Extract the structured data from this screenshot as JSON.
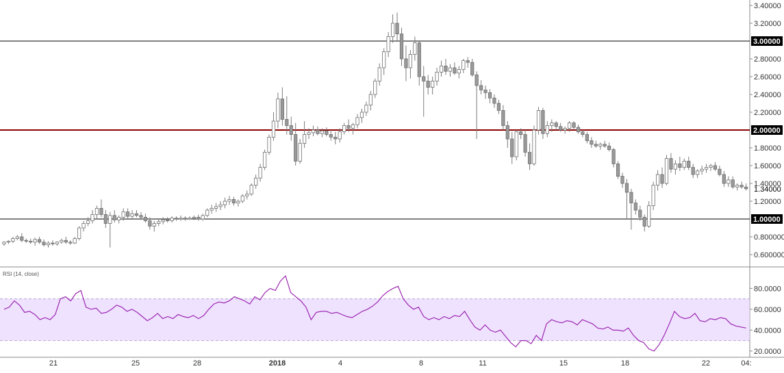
{
  "chart_data": [
    {
      "type": "candlestick",
      "name_label": "",
      "y_ticks": [
        "3.40000",
        "3.20000",
        "2.80000",
        "2.60000",
        "2.40000",
        "2.20000",
        "1.80000",
        "1.60000",
        "1.40000",
        "1.20000",
        "0.800000",
        "0.600000"
      ],
      "y_tick_values": [
        3.4,
        3.2,
        2.8,
        2.6,
        2.4,
        2.2,
        1.8,
        1.6,
        1.4,
        1.2,
        0.8,
        0.6
      ],
      "ylim": [
        0.5,
        3.45
      ],
      "horizontal_lines": [
        {
          "value": 3.0,
          "label": "3.00000",
          "color": "#000000"
        },
        {
          "value": 2.0,
          "label": "2.00000",
          "color": "#8b0000"
        },
        {
          "value": 1.0,
          "label": "1.00000",
          "color": "#000000"
        }
      ],
      "last_price": {
        "value": 1.34,
        "label": "1.34000"
      },
      "candles": [
        [
          0.72,
          0.75,
          0.7,
          0.74
        ],
        [
          0.74,
          0.76,
          0.72,
          0.75
        ],
        [
          0.75,
          0.8,
          0.73,
          0.78
        ],
        [
          0.78,
          0.82,
          0.76,
          0.8
        ],
        [
          0.8,
          0.84,
          0.74,
          0.76
        ],
        [
          0.76,
          0.78,
          0.73,
          0.75
        ],
        [
          0.75,
          0.78,
          0.72,
          0.74
        ],
        [
          0.74,
          0.79,
          0.7,
          0.77
        ],
        [
          0.77,
          0.8,
          0.72,
          0.74
        ],
        [
          0.74,
          0.77,
          0.69,
          0.71
        ],
        [
          0.71,
          0.75,
          0.68,
          0.73
        ],
        [
          0.73,
          0.76,
          0.7,
          0.72
        ],
        [
          0.72,
          0.75,
          0.7,
          0.74
        ],
        [
          0.74,
          0.78,
          0.72,
          0.76
        ],
        [
          0.76,
          0.8,
          0.72,
          0.74
        ],
        [
          0.74,
          0.76,
          0.71,
          0.73
        ],
        [
          0.73,
          0.8,
          0.72,
          0.78
        ],
        [
          0.78,
          0.92,
          0.76,
          0.9
        ],
        [
          0.9,
          0.98,
          0.86,
          0.95
        ],
        [
          0.95,
          1.02,
          0.92,
          0.98
        ],
        [
          0.98,
          1.1,
          0.95,
          1.05
        ],
        [
          1.05,
          1.15,
          1.0,
          1.12
        ],
        [
          1.12,
          1.22,
          1.02,
          1.05
        ],
        [
          1.05,
          1.1,
          0.9,
          0.95
        ],
        [
          0.95,
          1.08,
          0.68,
          1.04
        ],
        [
          1.04,
          1.1,
          0.96,
          0.99
        ],
        [
          0.99,
          1.04,
          0.95,
          1.02
        ],
        [
          1.02,
          1.12,
          0.98,
          1.08
        ],
        [
          1.08,
          1.12,
          1.0,
          1.03
        ],
        [
          1.03,
          1.1,
          1.0,
          1.06
        ],
        [
          1.06,
          1.1,
          1.02,
          1.04
        ],
        [
          1.04,
          1.08,
          0.99,
          1.02
        ],
        [
          1.02,
          1.06,
          0.96,
          0.98
        ],
        [
          0.98,
          1.02,
          0.88,
          0.92
        ],
        [
          0.92,
          0.98,
          0.86,
          0.95
        ],
        [
          0.95,
          1.0,
          0.92,
          0.97
        ],
        [
          0.97,
          1.02,
          0.94,
          0.99
        ],
        [
          0.99,
          1.02,
          0.96,
          0.98
        ],
        [
          0.98,
          1.03,
          0.96,
          1.01
        ],
        [
          1.01,
          1.03,
          0.98,
          1.0
        ],
        [
          1.0,
          1.04,
          0.98,
          1.01
        ],
        [
          1.01,
          1.03,
          0.98,
          1.0
        ],
        [
          1.0,
          1.03,
          0.99,
          1.01
        ],
        [
          1.01,
          1.04,
          0.99,
          1.02
        ],
        [
          1.02,
          1.05,
          0.98,
          1.0
        ],
        [
          1.0,
          1.06,
          0.98,
          1.04
        ],
        [
          1.04,
          1.12,
          1.02,
          1.1
        ],
        [
          1.1,
          1.16,
          1.06,
          1.12
        ],
        [
          1.12,
          1.18,
          1.08,
          1.14
        ],
        [
          1.14,
          1.2,
          1.1,
          1.16
        ],
        [
          1.16,
          1.24,
          1.12,
          1.2
        ],
        [
          1.2,
          1.26,
          1.16,
          1.22
        ],
        [
          1.22,
          1.25,
          1.15,
          1.18
        ],
        [
          1.18,
          1.22,
          1.14,
          1.2
        ],
        [
          1.2,
          1.28,
          1.18,
          1.26
        ],
        [
          1.26,
          1.32,
          1.22,
          1.28
        ],
        [
          1.28,
          1.4,
          1.26,
          1.38
        ],
        [
          1.38,
          1.5,
          1.34,
          1.46
        ],
        [
          1.46,
          1.62,
          1.42,
          1.58
        ],
        [
          1.58,
          1.78,
          1.55,
          1.75
        ],
        [
          1.75,
          1.95,
          1.72,
          1.92
        ],
        [
          1.92,
          2.2,
          1.88,
          2.1
        ],
        [
          2.1,
          2.42,
          2.02,
          2.35
        ],
        [
          2.35,
          2.48,
          2.05,
          2.12
        ],
        [
          2.12,
          2.38,
          1.95,
          2.05
        ],
        [
          2.05,
          2.15,
          1.88,
          1.95
        ],
        [
          1.95,
          2.08,
          1.6,
          1.65
        ],
        [
          1.65,
          1.9,
          1.62,
          1.85
        ],
        [
          1.85,
          2.1,
          1.8,
          1.95
        ],
        [
          1.95,
          2.02,
          1.9,
          1.97
        ],
        [
          1.97,
          2.05,
          1.93,
          2.0
        ],
        [
          2.0,
          2.04,
          1.94,
          1.96
        ],
        [
          1.96,
          2.02,
          1.92,
          1.99
        ],
        [
          1.99,
          2.03,
          1.93,
          1.95
        ],
        [
          1.95,
          2.0,
          1.88,
          1.92
        ],
        [
          1.92,
          1.98,
          1.84,
          1.9
        ],
        [
          1.9,
          2.02,
          1.86,
          1.98
        ],
        [
          1.98,
          2.08,
          1.95,
          2.05
        ],
        [
          2.05,
          2.12,
          1.98,
          2.02
        ],
        [
          2.02,
          2.08,
          1.95,
          2.06
        ],
        [
          2.06,
          2.18,
          2.02,
          2.14
        ],
        [
          2.14,
          2.24,
          2.08,
          2.2
        ],
        [
          2.2,
          2.32,
          2.16,
          2.28
        ],
        [
          2.28,
          2.44,
          2.22,
          2.4
        ],
        [
          2.4,
          2.58,
          2.36,
          2.55
        ],
        [
          2.55,
          2.75,
          2.5,
          2.7
        ],
        [
          2.7,
          2.92,
          2.62,
          2.88
        ],
        [
          2.88,
          3.1,
          2.82,
          3.05
        ],
        [
          3.05,
          3.3,
          2.98,
          3.2
        ],
        [
          3.2,
          3.32,
          3.0,
          3.08
        ],
        [
          3.08,
          3.15,
          2.72,
          2.8
        ],
        [
          2.8,
          2.95,
          2.55,
          2.7
        ],
        [
          2.7,
          2.9,
          2.58,
          2.85
        ],
        [
          2.85,
          3.05,
          2.78,
          2.98
        ],
        [
          2.98,
          3.0,
          2.5,
          2.6
        ],
        [
          2.6,
          2.72,
          2.15,
          2.55
        ],
        [
          2.55,
          2.62,
          2.4,
          2.48
        ],
        [
          2.48,
          2.6,
          2.4,
          2.55
        ],
        [
          2.55,
          2.7,
          2.5,
          2.65
        ],
        [
          2.65,
          2.78,
          2.6,
          2.72
        ],
        [
          2.72,
          2.8,
          2.62,
          2.66
        ],
        [
          2.66,
          2.74,
          2.6,
          2.7
        ],
        [
          2.7,
          2.76,
          2.62,
          2.64
        ],
        [
          2.64,
          2.72,
          2.58,
          2.68
        ],
        [
          2.68,
          2.8,
          2.64,
          2.78
        ],
        [
          2.78,
          2.82,
          2.7,
          2.76
        ],
        [
          2.76,
          2.8,
          2.6,
          2.62
        ],
        [
          2.62,
          2.66,
          1.9,
          2.5
        ],
        [
          2.5,
          2.56,
          2.4,
          2.45
        ],
        [
          2.45,
          2.5,
          2.35,
          2.42
        ],
        [
          2.42,
          2.46,
          2.3,
          2.36
        ],
        [
          2.36,
          2.4,
          2.25,
          2.3
        ],
        [
          2.3,
          2.34,
          2.18,
          2.22
        ],
        [
          2.22,
          2.28,
          2.0,
          2.05
        ],
        [
          2.05,
          2.1,
          1.8,
          1.9
        ],
        [
          1.9,
          1.98,
          1.62,
          1.7
        ],
        [
          1.7,
          2.0,
          1.66,
          1.98
        ],
        [
          1.98,
          2.02,
          1.9,
          1.95
        ],
        [
          1.95,
          2.0,
          1.7,
          1.75
        ],
        [
          1.75,
          1.85,
          1.55,
          1.62
        ],
        [
          1.62,
          2.05,
          1.6,
          2.0
        ],
        [
          2.0,
          2.26,
          1.95,
          2.22
        ],
        [
          2.22,
          2.25,
          1.9,
          1.96
        ],
        [
          1.96,
          2.1,
          1.92,
          2.05
        ],
        [
          2.05,
          2.12,
          1.98,
          2.08
        ],
        [
          2.08,
          2.1,
          2.0,
          2.04
        ],
        [
          2.04,
          2.08,
          1.98,
          2.0
        ],
        [
          2.0,
          2.04,
          1.96,
          2.02
        ],
        [
          2.02,
          2.1,
          1.98,
          2.08
        ],
        [
          2.08,
          2.1,
          2.0,
          2.03
        ],
        [
          2.03,
          2.06,
          1.96,
          1.98
        ],
        [
          1.98,
          2.0,
          1.92,
          1.95
        ],
        [
          1.95,
          1.98,
          1.85,
          1.88
        ],
        [
          1.88,
          1.92,
          1.8,
          1.84
        ],
        [
          1.84,
          1.88,
          1.8,
          1.82
        ],
        [
          1.82,
          1.86,
          1.78,
          1.84
        ],
        [
          1.84,
          1.88,
          1.8,
          1.82
        ],
        [
          1.82,
          1.86,
          1.76,
          1.78
        ],
        [
          1.78,
          1.8,
          1.58,
          1.62
        ],
        [
          1.62,
          1.65,
          1.45,
          1.48
        ],
        [
          1.48,
          1.52,
          1.35,
          1.4
        ],
        [
          1.4,
          1.45,
          1.0,
          1.3
        ],
        [
          1.3,
          1.34,
          0.88,
          1.18
        ],
        [
          1.18,
          1.22,
          1.05,
          1.1
        ],
        [
          1.1,
          1.15,
          0.98,
          1.02
        ],
        [
          1.02,
          1.05,
          0.86,
          0.92
        ],
        [
          0.92,
          1.2,
          0.9,
          1.15
        ],
        [
          1.15,
          1.42,
          1.1,
          1.38
        ],
        [
          1.38,
          1.55,
          1.32,
          1.5
        ],
        [
          1.5,
          1.58,
          1.35,
          1.4
        ],
        [
          1.4,
          1.72,
          1.38,
          1.68
        ],
        [
          1.68,
          1.74,
          1.52,
          1.56
        ],
        [
          1.56,
          1.66,
          1.5,
          1.62
        ],
        [
          1.62,
          1.7,
          1.54,
          1.58
        ],
        [
          1.58,
          1.68,
          1.55,
          1.65
        ],
        [
          1.65,
          1.7,
          1.55,
          1.58
        ],
        [
          1.58,
          1.62,
          1.46,
          1.5
        ],
        [
          1.5,
          1.56,
          1.46,
          1.54
        ],
        [
          1.54,
          1.6,
          1.5,
          1.56
        ],
        [
          1.56,
          1.62,
          1.52,
          1.58
        ],
        [
          1.58,
          1.62,
          1.54,
          1.6
        ],
        [
          1.6,
          1.64,
          1.54,
          1.56
        ],
        [
          1.56,
          1.6,
          1.48,
          1.5
        ],
        [
          1.5,
          1.54,
          1.36,
          1.4
        ],
        [
          1.4,
          1.48,
          1.36,
          1.44
        ],
        [
          1.44,
          1.48,
          1.34,
          1.36
        ],
        [
          1.36,
          1.4,
          1.32,
          1.38
        ],
        [
          1.38,
          1.42,
          1.34,
          1.36
        ],
        [
          1.36,
          1.4,
          1.32,
          1.34
        ]
      ]
    },
    {
      "type": "line",
      "legend": "RSI (14, close)",
      "y_ticks": [
        "80.0000",
        "60.0000",
        "40.0000",
        "20.0000"
      ],
      "y_tick_values": [
        80,
        60,
        40,
        20
      ],
      "ylim": [
        14,
        94
      ],
      "band": [
        30,
        70
      ],
      "colors": {
        "line": "#9c27b0",
        "band": "#e8d6ff"
      },
      "values": [
        60,
        62,
        68,
        64,
        57,
        58,
        55,
        50,
        52,
        50,
        55,
        70,
        72,
        68,
        75,
        78,
        62,
        60,
        61,
        56,
        57,
        60,
        64,
        62,
        58,
        60,
        57,
        53,
        49,
        52,
        56,
        51,
        53,
        51,
        55,
        53,
        52,
        54,
        51,
        54,
        60,
        65,
        67,
        66,
        68,
        72,
        70,
        68,
        65,
        72,
        69,
        76,
        80,
        78,
        87,
        92,
        76,
        72,
        68,
        62,
        50,
        57,
        58,
        58,
        56,
        57,
        55,
        53,
        52,
        55,
        58,
        60,
        63,
        67,
        73,
        77,
        80,
        82,
        70,
        64,
        60,
        62,
        53,
        50,
        52,
        50,
        53,
        51,
        54,
        53,
        58,
        50,
        43,
        40,
        45,
        40,
        38,
        40,
        34,
        28,
        24,
        30,
        30,
        27,
        35,
        30,
        46,
        50,
        48,
        47,
        49,
        48,
        45,
        50,
        48,
        46,
        42,
        41,
        43,
        40,
        40,
        39,
        42,
        35,
        30,
        28,
        22,
        20,
        26,
        35,
        46,
        58,
        53,
        51,
        52,
        56,
        49,
        48,
        51,
        50,
        52,
        51,
        46,
        44,
        43,
        42
      ],
      "x_ticks": [
        "21",
        "25",
        "28",
        "2018",
        "4",
        "8",
        "11",
        "15",
        "18",
        "22",
        "04:"
      ]
    }
  ]
}
